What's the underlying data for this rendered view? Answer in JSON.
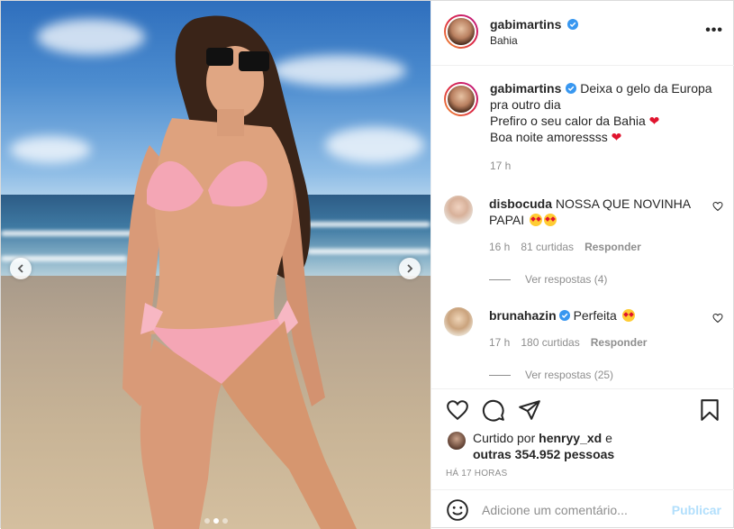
{
  "post": {
    "author": "gabimartins",
    "location": "Bahia",
    "more_label": "•••",
    "caption": {
      "username": "gabimartins",
      "line1": "Deixa o gelo da Europa pra outro dia",
      "line2": "Prefiro o seu calor da Bahia",
      "line3": "Boa noite amoressss",
      "heart": "❤",
      "time": "17 h"
    },
    "comments": [
      {
        "username": "disbocuda",
        "text": "NOSSA QUE NOVINHA PAPAI",
        "time": "16 h",
        "likes": "81 curtidas",
        "reply": "Responder",
        "view_replies": "Ver respostas (4)"
      },
      {
        "username": "brunahazin",
        "text": "Perfeita",
        "time": "17 h",
        "likes": "180 curtidas",
        "reply": "Responder",
        "view_replies": "Ver respostas (25)"
      }
    ],
    "liked_by": {
      "prefix": "Curtido por",
      "user": "henryy_xd",
      "connector": "e",
      "others": "outras 354.952 pessoas"
    },
    "timestamp": "HÁ 17 HORAS",
    "comment_input": {
      "placeholder": "Adicione um comentário...",
      "value": ""
    },
    "publish_label": "Publicar",
    "carousel": {
      "total": 3,
      "current": 2
    }
  },
  "icons": {
    "verified": "verified-badge-icon",
    "like": "heart-outline-icon",
    "comment": "comment-bubble-icon",
    "share": "paper-plane-icon",
    "save": "bookmark-icon",
    "emoji": "smiley-icon",
    "prev": "chevron-left-icon",
    "next": "chevron-right-icon"
  },
  "colors": {
    "verified_blue": "#3897f0",
    "publish_disabled": "#b2dffc",
    "secondary_text": "#8e8e8e"
  }
}
